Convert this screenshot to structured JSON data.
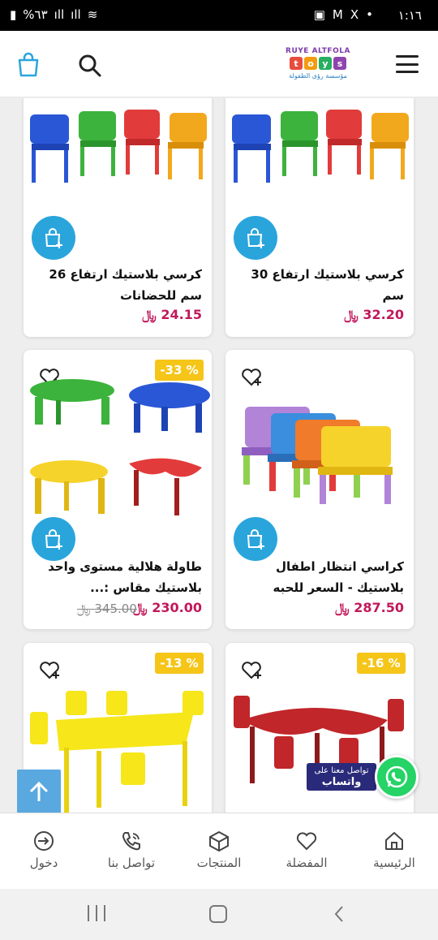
{
  "status_bar": {
    "time": "١:١٦",
    "battery": "%٦٣"
  },
  "header": {
    "logo_top": "RUYE ALTFOLA",
    "logo_letters": [
      "t",
      "o",
      "y",
      "s"
    ],
    "logo_bottom": "مؤسسة رؤى الطفولة"
  },
  "products": [
    {
      "title": "كرسي بلاستيك ارتفاع 30 سم",
      "price": "32.20",
      "currency": "﷼"
    },
    {
      "title": "كرسي بلاستيك ارتفاع 26 سم للحضانات",
      "price": "24.15",
      "currency": "﷼"
    },
    {
      "title": "كراسي انتظار اطفال بلاستيك - السعر للحبه",
      "price": "287.50",
      "currency": "﷼"
    },
    {
      "title": "طاولة هلالية مستوى واحد بلاستيك مقاس :...",
      "price": "230.00",
      "old_price": "345.00",
      "discount": "-33 %",
      "currency": "﷼"
    },
    {
      "discount": "-16 %"
    },
    {
      "discount": "-13 %"
    }
  ],
  "whatsapp": {
    "line1": "تواصل معنا على",
    "line2": "واتساب"
  },
  "bottom_nav": [
    {
      "label": "الرئيسية",
      "icon": "home-icon"
    },
    {
      "label": "المفضلة",
      "icon": "heart-icon"
    },
    {
      "label": "المنتجات",
      "icon": "box-icon"
    },
    {
      "label": "تواصل بنا",
      "icon": "phone-icon"
    },
    {
      "label": "دخول",
      "icon": "login-icon"
    }
  ],
  "colors": {
    "accent": "#2aa5dc",
    "price": "#c2185b",
    "badge": "#f5c518",
    "whatsapp": "#25d366"
  }
}
